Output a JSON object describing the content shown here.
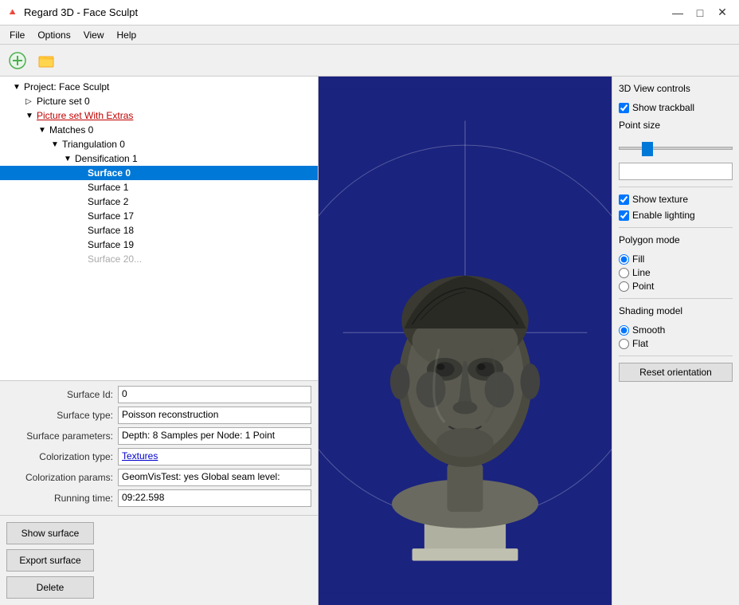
{
  "titleBar": {
    "icon": "🔴",
    "title": "Regard 3D - Face Sculpt",
    "minimize": "—",
    "maximize": "□",
    "close": "✕"
  },
  "menuBar": {
    "items": [
      "File",
      "Options",
      "View",
      "Help"
    ]
  },
  "toolbar": {
    "btn1": "➕",
    "btn2": "📋"
  },
  "tree": {
    "items": [
      {
        "label": "Project: Face Sculpt",
        "indent": 0,
        "expand": "▼",
        "selected": false,
        "underline": false
      },
      {
        "label": "Picture set 0",
        "indent": 1,
        "expand": "▷",
        "selected": false,
        "underline": false
      },
      {
        "label": "Picture set With Extras",
        "indent": 1,
        "expand": "▼",
        "selected": false,
        "underline": true
      },
      {
        "label": "Matches 0",
        "indent": 2,
        "expand": "▼",
        "selected": false,
        "underline": false
      },
      {
        "label": "Triangulation 0",
        "indent": 3,
        "expand": "▼",
        "selected": false,
        "underline": false
      },
      {
        "label": "Densification 1",
        "indent": 4,
        "expand": "▼",
        "selected": false,
        "underline": false
      },
      {
        "label": "Surface 0",
        "indent": 5,
        "expand": "",
        "selected": true,
        "underline": false
      },
      {
        "label": "Surface 1",
        "indent": 5,
        "expand": "",
        "selected": false,
        "underline": false
      },
      {
        "label": "Surface 2",
        "indent": 5,
        "expand": "",
        "selected": false,
        "underline": false
      },
      {
        "label": "Surface 17",
        "indent": 5,
        "expand": "",
        "selected": false,
        "underline": false
      },
      {
        "label": "Surface 18",
        "indent": 5,
        "expand": "",
        "selected": false,
        "underline": false
      },
      {
        "label": "Surface 19",
        "indent": 5,
        "expand": "",
        "selected": false,
        "underline": false
      }
    ]
  },
  "properties": {
    "surfaceId": {
      "label": "Surface Id:",
      "value": "0"
    },
    "surfaceType": {
      "label": "Surface type:",
      "value": "Poisson reconstruction"
    },
    "surfaceParams": {
      "label": "Surface parameters:",
      "value": "Depth: 8 Samples per Node: 1 Point"
    },
    "colorizationType": {
      "label": "Colorization type:",
      "value": "Textures",
      "highlight": true
    },
    "colorizationParams": {
      "label": "Colorization params:",
      "value": "GeomVisTest: yes Global seam level:"
    },
    "runningTime": {
      "label": "Running time:",
      "value": "09:22.598"
    }
  },
  "buttons": {
    "showSurface": "Show surface",
    "exportSurface": "Export surface",
    "delete": "Delete"
  },
  "viewControls": {
    "title": "3D View controls",
    "showTrackball": {
      "label": "Show trackball",
      "checked": true
    },
    "pointSizeLabel": "Point size",
    "showTexture": {
      "label": "Show texture",
      "checked": true
    },
    "enableLighting": {
      "label": "Enable lighting",
      "checked": true
    },
    "polygonModeLabel": "Polygon mode",
    "polygonModes": [
      {
        "label": "Fill",
        "checked": true
      },
      {
        "label": "Line",
        "checked": false
      },
      {
        "label": "Point",
        "checked": false
      }
    ],
    "shadingModelLabel": "Shading model",
    "shadingModels": [
      {
        "label": "Smooth",
        "checked": true
      },
      {
        "label": "Flat",
        "checked": false
      }
    ],
    "resetBtn": "Reset orientation"
  }
}
